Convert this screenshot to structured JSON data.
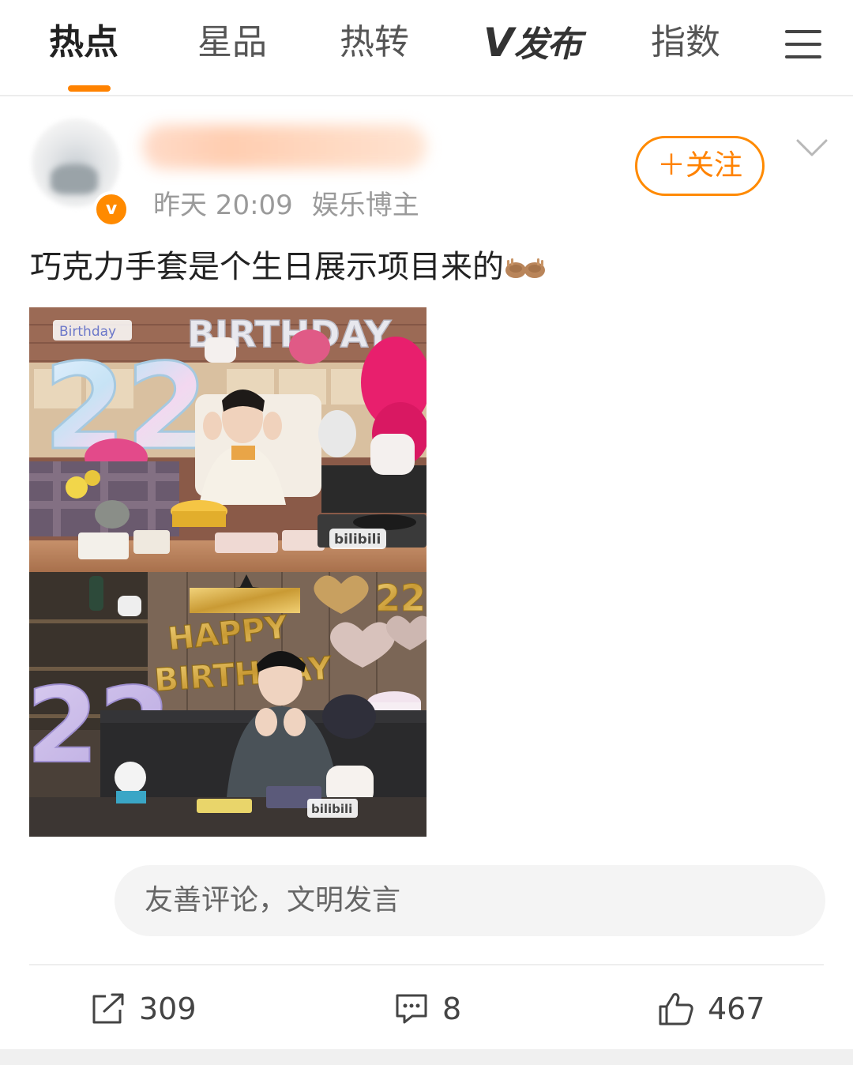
{
  "tabs": [
    {
      "label": "热点",
      "active": true
    },
    {
      "label": "星品",
      "active": false
    },
    {
      "label": "热转",
      "active": false
    },
    {
      "label": "发布",
      "logo_prefix": "V",
      "active": false
    },
    {
      "label": "指数",
      "active": false
    }
  ],
  "icons": {
    "menu": "menu-icon",
    "more": "chevron-down-icon",
    "verified": "verified-badge-icon",
    "repost": "share-icon",
    "comment": "comment-icon",
    "like": "thumbs-up-icon"
  },
  "post": {
    "verified_badge": "v",
    "time": "昨天 20:09",
    "source": "娱乐博主",
    "follow_label": "＋关注",
    "text": "巧克力手套是个生日展示项目来的",
    "emoji": "palms-up-together-emoji",
    "photo": {
      "top_panel": {
        "banner_small": "Birthday",
        "banner_large": "BIRTHDAY",
        "balloon_number": "22",
        "watermark": "bilibili"
      },
      "bottom_panel": {
        "banner_line1": "HAPPY",
        "banner_line2": "BIRTHDAY",
        "balloon_number_left": "22",
        "balloon_number_right": "22",
        "watermark": "bilibili"
      }
    }
  },
  "comment_placeholder": "友善评论，文明发言",
  "actions": {
    "reposts": "309",
    "comments": "8",
    "likes": "467"
  },
  "colors": {
    "accent": "#ff8200",
    "text_primary": "#222222",
    "text_secondary": "#9a9a9a"
  }
}
